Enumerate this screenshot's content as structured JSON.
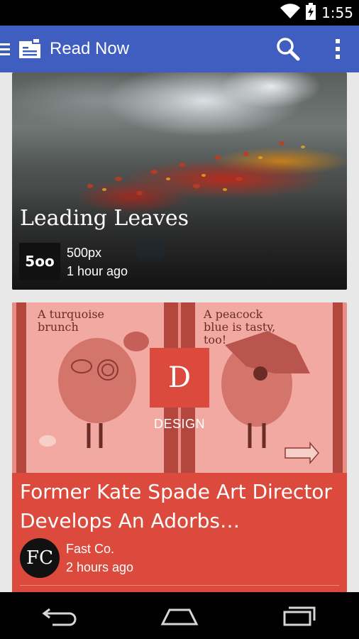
{
  "status_bar": {
    "time": "1:55",
    "icons": [
      "wifi-icon",
      "battery-charging-icon"
    ]
  },
  "app_bar": {
    "title": "Read Now",
    "color": "#3f5ec0",
    "icons": [
      "menu-icon",
      "play-newsstand-logo",
      "search-icon",
      "overflow-menu-icon"
    ]
  },
  "feed": {
    "cards": [
      {
        "headline": "Leading Leaves",
        "source_logo": "5oo",
        "source": "500px",
        "time": "1 hour ago"
      },
      {
        "category_letter": "D",
        "category": "DESIGN",
        "image_text_left": "A turquoise brunch",
        "image_text_right": "A peacock blue is tasty, too!",
        "headline": "Former Kate Spade Art Director Develops An Adorbs…",
        "source_logo": "FC",
        "source": "Fast Co.",
        "time": "2 hours ago",
        "color": "#dc4a3d"
      }
    ]
  },
  "nav_bar": {
    "icons": [
      "back-icon",
      "home-icon",
      "recent-apps-icon"
    ]
  }
}
